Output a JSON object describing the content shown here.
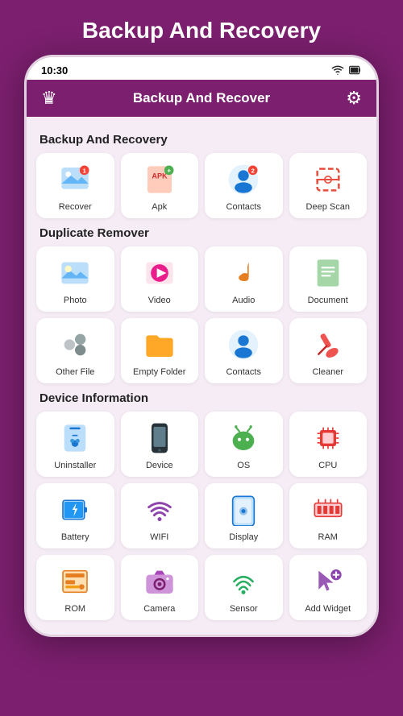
{
  "page": {
    "title": "Backup And Recovery",
    "phone": {
      "status_time": "10:30",
      "topbar_title": "Backup And Recover"
    },
    "sections": [
      {
        "id": "backup",
        "label": "Backup And Recovery",
        "items": [
          {
            "id": "recover",
            "label": "Recover",
            "icon": "recover"
          },
          {
            "id": "apk",
            "label": "Apk",
            "icon": "apk"
          },
          {
            "id": "contacts-backup",
            "label": "Contacts",
            "icon": "contacts-backup"
          },
          {
            "id": "deep-scan",
            "label": "Deep Scan",
            "icon": "deepscan"
          }
        ]
      },
      {
        "id": "duplicate",
        "label": "Duplicate Remover",
        "items": [
          {
            "id": "photo",
            "label": "Photo",
            "icon": "photo"
          },
          {
            "id": "video",
            "label": "Video",
            "icon": "video"
          },
          {
            "id": "audio",
            "label": "Audio",
            "icon": "audio"
          },
          {
            "id": "document",
            "label": "Document",
            "icon": "document"
          },
          {
            "id": "other-file",
            "label": "Other File",
            "icon": "otherfile"
          },
          {
            "id": "empty-folder",
            "label": "Empty Folder",
            "icon": "emptyfolder"
          },
          {
            "id": "contacts-dup",
            "label": "Contacts",
            "icon": "contacts-dup"
          },
          {
            "id": "cleaner",
            "label": "Cleaner",
            "icon": "cleaner"
          }
        ]
      },
      {
        "id": "device",
        "label": "Device Information",
        "items": [
          {
            "id": "uninstaller",
            "label": "Uninstaller",
            "icon": "uninstaller"
          },
          {
            "id": "device",
            "label": "Device",
            "icon": "device"
          },
          {
            "id": "os",
            "label": "OS",
            "icon": "os"
          },
          {
            "id": "cpu",
            "label": "CPU",
            "icon": "cpu"
          },
          {
            "id": "battery",
            "label": "Battery",
            "icon": "battery"
          },
          {
            "id": "wifi",
            "label": "WIFI",
            "icon": "wifi"
          },
          {
            "id": "display",
            "label": "Display",
            "icon": "display"
          },
          {
            "id": "ram",
            "label": "RAM",
            "icon": "ram"
          },
          {
            "id": "rom",
            "label": "ROM",
            "icon": "rom"
          },
          {
            "id": "camera",
            "label": "Camera",
            "icon": "camera"
          },
          {
            "id": "sensor",
            "label": "Sensor",
            "icon": "sensor"
          },
          {
            "id": "add-widget",
            "label": "Add Widget",
            "icon": "addwidget"
          }
        ]
      }
    ]
  }
}
